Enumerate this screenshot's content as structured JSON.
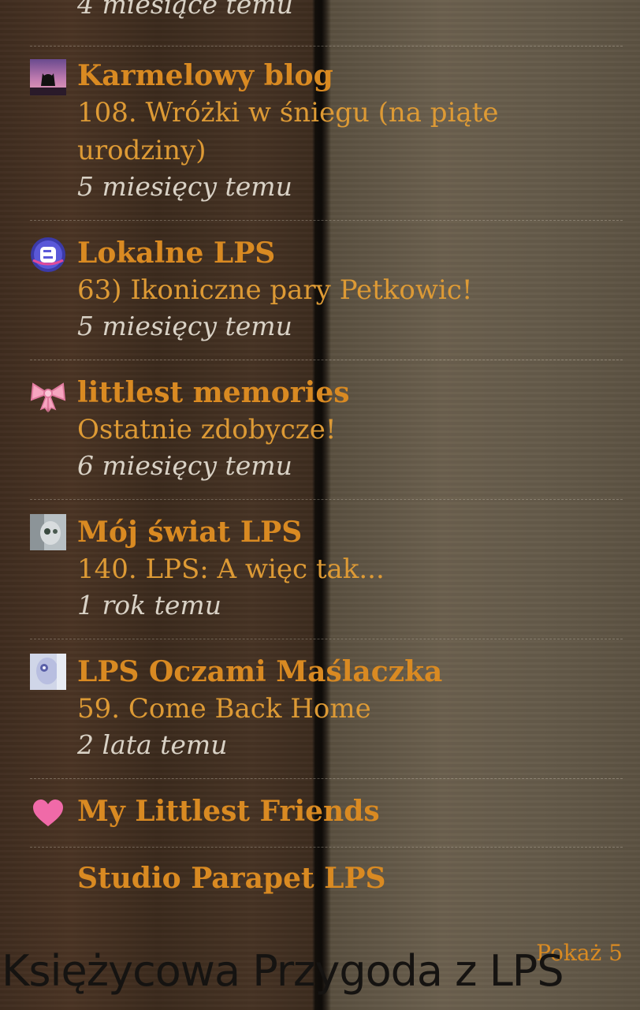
{
  "blog_list": {
    "top_partial_time": "4 miesiące temu",
    "items": [
      {
        "name": "Karmelowy blog",
        "post": "108. Wróżki w śniegu (na piąte urodziny)",
        "time": "5 miesięcy temu",
        "icon": "cat-silhouette-thumbnail-icon"
      },
      {
        "name": "Lokalne LPS",
        "post": "63) Ikoniczne pary Petkowic!",
        "time": "5 miesięcy temu",
        "icon": "blogger-logo-icon"
      },
      {
        "name": "littlest memories",
        "post": "Ostatnie zdobycze!",
        "time": "6 miesięcy temu",
        "icon": "pink-bow-icon"
      },
      {
        "name": "Mój świat LPS",
        "post": "140. LPS: A więc tak...",
        "time": "1 rok temu",
        "icon": "pet-photo-thumbnail-icon"
      },
      {
        "name": "LPS Oczami Maślaczka",
        "post": "59. Come Back Home",
        "time": "2 lata temu",
        "icon": "lps-figure-thumbnail-icon"
      },
      {
        "name": "My Littlest Friends",
        "icon": "pink-heart-icon"
      },
      {
        "name": "Studio Parapet LPS"
      }
    ],
    "show_more_label": "Pokaż 5"
  },
  "page_caption": "Księżycowa Przygoda z LPS",
  "colors": {
    "link_orange": "#d98a22",
    "post_orange": "#dd9a35",
    "time_text": "#d9d2c6",
    "caption_text": "#151311"
  }
}
